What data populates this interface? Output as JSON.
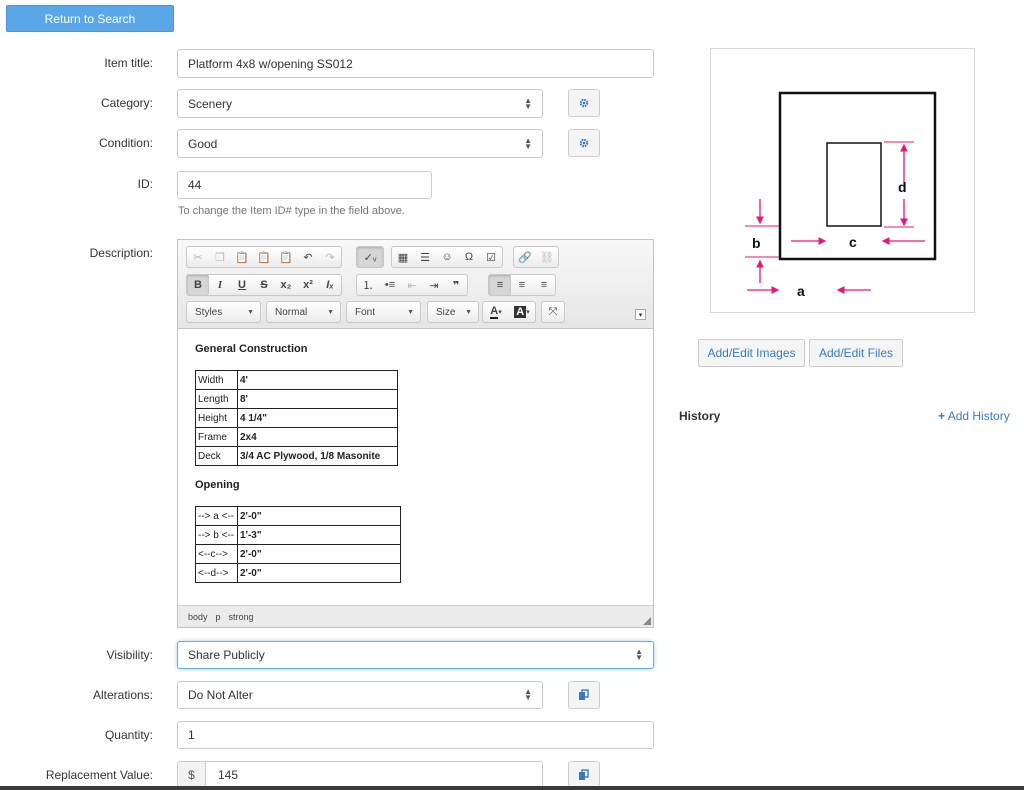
{
  "return_button": "Return to Search",
  "form": {
    "item_title": {
      "label": "Item title:",
      "value": "Platform 4x8 w/opening SS012"
    },
    "category": {
      "label": "Category:",
      "value": "Scenery"
    },
    "condition": {
      "label": "Condition:",
      "value": "Good"
    },
    "id": {
      "label": "ID:",
      "value": "44",
      "help": "To change the Item ID# type in the field above."
    },
    "description": {
      "label": "Description:"
    },
    "visibility": {
      "label": "Visibility:",
      "value": "Share Publicly"
    },
    "alterations": {
      "label": "Alterations:",
      "value": "Do Not Alter"
    },
    "quantity": {
      "label": "Quantity:",
      "value": "1"
    },
    "replacement_value": {
      "label": "Replacement Value:",
      "currency": "$",
      "value": "145"
    }
  },
  "editor": {
    "combos": {
      "styles": "Styles",
      "format": "Normal",
      "font": "Font",
      "size": "Size"
    },
    "general_heading": "General Construction",
    "general_rows": [
      {
        "key": "Width",
        "value": "4'"
      },
      {
        "key": "Length",
        "value": "8'"
      },
      {
        "key": "Height",
        "value": "4 1/4\""
      },
      {
        "key": "Frame",
        "value": "2x4"
      },
      {
        "key": "Deck",
        "value": "3/4 AC Plywood, 1/8 Masonite"
      }
    ],
    "opening_heading": "Opening",
    "opening_rows": [
      {
        "key": "--> a <--",
        "value": "2'-0\""
      },
      {
        "key": "--> b <--",
        "value": "1'-3\""
      },
      {
        "key": "<--c-->",
        "value": "2'-0\""
      },
      {
        "key": "<--d-->",
        "value": "2'-0\""
      }
    ],
    "path": [
      "body",
      "p",
      "strong"
    ]
  },
  "diagram": {
    "labels": {
      "a": "a",
      "b": "b",
      "c": "c",
      "d": "d"
    },
    "arrow_color": "#e8157a"
  },
  "buttons": {
    "add_edit_images": "Add/Edit Images",
    "add_edit_files": "Add/Edit Files"
  },
  "history": {
    "title": "History",
    "add": "Add History"
  },
  "colors": {
    "primary": "#5aa7e8",
    "link": "#3a7bbf"
  }
}
